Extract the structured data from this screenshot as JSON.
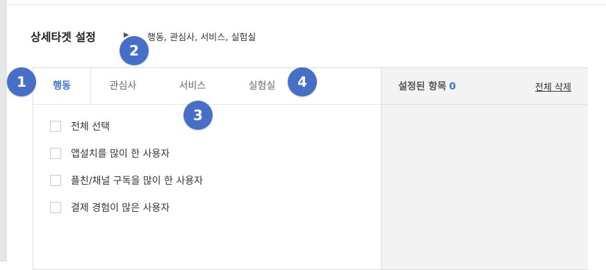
{
  "header": {
    "title": "상세타겟 설정",
    "separator": "▶",
    "subtitle": "행동, 관심사, 서비스, 실험실"
  },
  "tabs": [
    {
      "label": "행동",
      "active": true
    },
    {
      "label": "관심사",
      "active": false
    },
    {
      "label": "서비스",
      "active": false
    },
    {
      "label": "실험실",
      "active": false
    }
  ],
  "options": [
    {
      "label": "전체 선택",
      "checked": false
    },
    {
      "label": "앱설치를 많이 한 사용자",
      "checked": false
    },
    {
      "label": "플친/채널 구독을 많이 한 사용자",
      "checked": false
    },
    {
      "label": "결제 경험이 많은 사용자",
      "checked": false
    }
  ],
  "right_panel": {
    "selected_label": "설정된 항목",
    "selected_count": "0",
    "delete_all": "전체 삭제"
  },
  "badges": [
    "1",
    "2",
    "3",
    "4"
  ],
  "colors": {
    "accent": "#3b73d8",
    "badge": "#4670c8"
  }
}
